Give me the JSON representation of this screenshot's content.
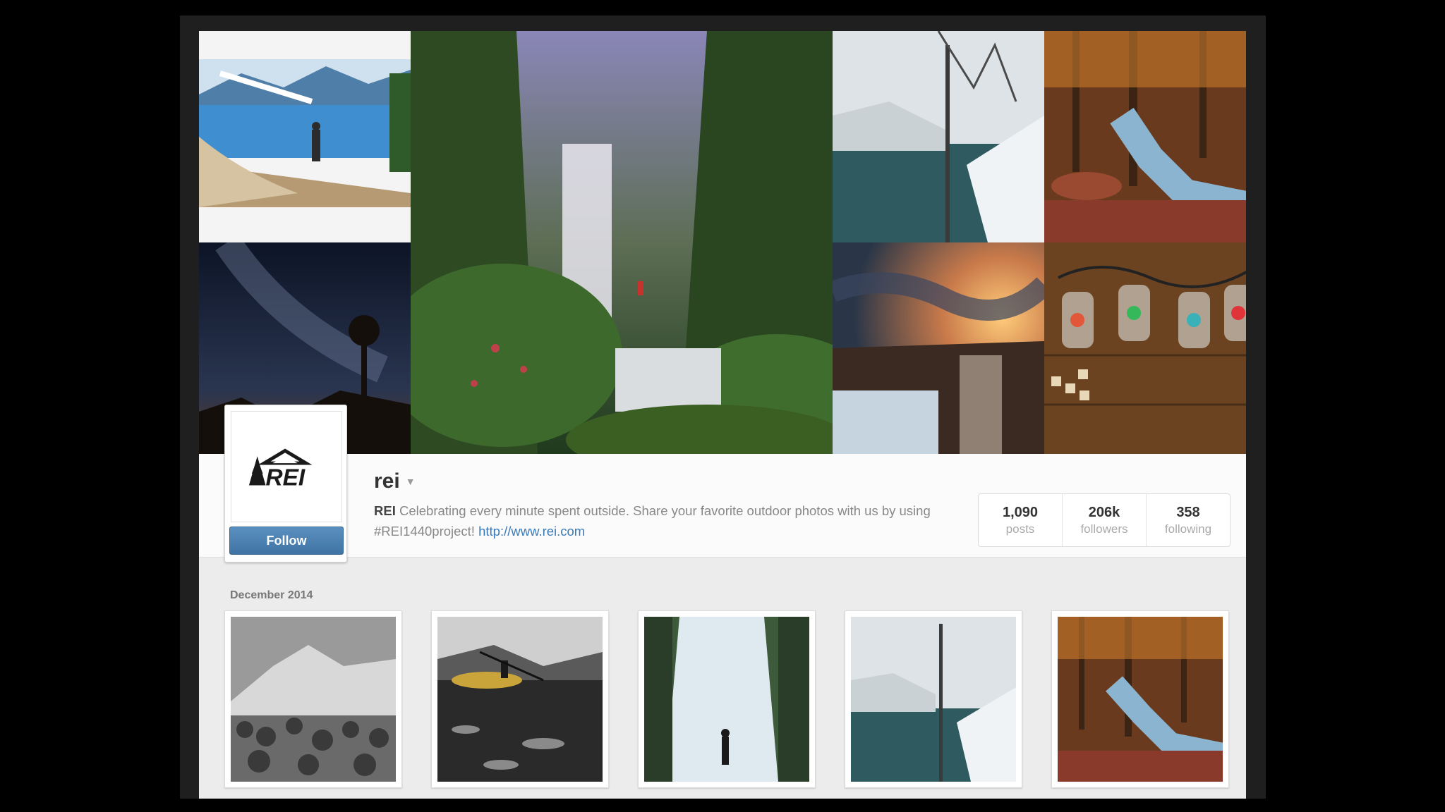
{
  "profile": {
    "username": "rei",
    "follow_label": "Follow",
    "bio_name": "REI",
    "bio_text": " Celebrating every minute spent outside. Share your favorite outdoor photos with us by using #REI1440project! ",
    "bio_link": "http://www.rei.com",
    "logo_text": "REI"
  },
  "stats": [
    {
      "value": "1,090",
      "label": "posts"
    },
    {
      "value": "206k",
      "label": "followers"
    },
    {
      "value": "358",
      "label": "following"
    }
  ],
  "section": {
    "label": "December 2014"
  },
  "cover_photos": [
    {
      "subject": "hiker-lake-photo"
    },
    {
      "subject": "waterfall-forest-photo"
    },
    {
      "subject": "snowy-river-photo"
    },
    {
      "subject": "autumn-stream-photo"
    },
    {
      "subject": "night-sky-photo"
    },
    {
      "subject": "sunset-waterfall-photo"
    },
    {
      "subject": "lantern-lights-photo"
    }
  ],
  "thumbnails": [
    {
      "subject": "snowy-mountain-photo"
    },
    {
      "subject": "kayaker-photo"
    },
    {
      "subject": "frozen-waterfall-photo"
    },
    {
      "subject": "snowy-river-photo"
    },
    {
      "subject": "autumn-stream-photo"
    }
  ],
  "colors": {
    "follow_button": "#4a7fb0",
    "link": "#3a7ab8"
  }
}
